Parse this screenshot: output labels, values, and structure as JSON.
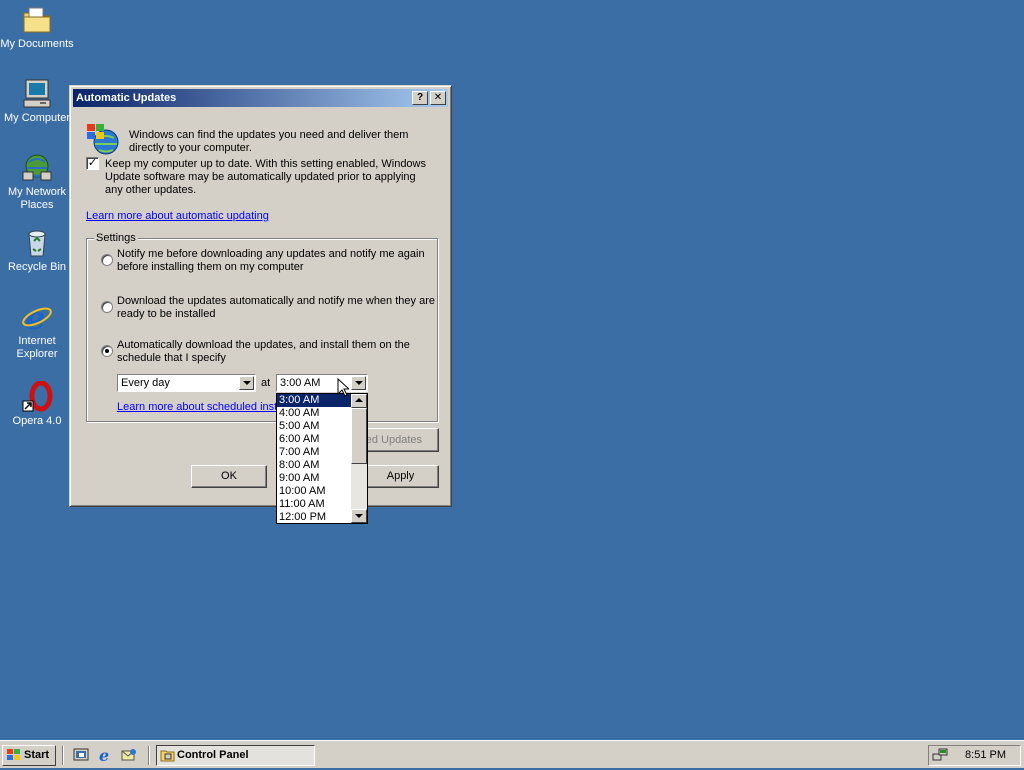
{
  "desktop": {
    "icons": [
      {
        "label": "My Documents",
        "icon": "folder-documents-icon"
      },
      {
        "label": "My Computer",
        "icon": "computer-icon"
      },
      {
        "label": "My Network\nPlaces",
        "icon": "network-places-icon"
      },
      {
        "label": "Recycle Bin",
        "icon": "recycle-bin-icon"
      },
      {
        "label": "Internet\nExplorer",
        "icon": "internet-explorer-icon"
      },
      {
        "label": "Opera 4.0",
        "icon": "opera-icon"
      }
    ]
  },
  "dialog": {
    "title": "Automatic Updates",
    "help_button": "?",
    "close_button": "✕",
    "intro_text": "Windows can find the updates you need and deliver them directly to your computer.",
    "keep_updated_checked": true,
    "keep_updated_text": "Keep my computer up to date. With this setting enabled, Windows Update software may be automatically updated prior to applying any other updates.",
    "learn_more_link": "Learn more about automatic updating",
    "settings_group_label": "Settings",
    "options": [
      {
        "text": "Notify me before downloading any updates and notify me again before installing them on my computer",
        "selected": false
      },
      {
        "text": "Download the updates automatically and notify me when they are ready to be installed",
        "selected": false
      },
      {
        "text": "Automatically download the updates, and install them on the schedule that I specify",
        "selected": true
      }
    ],
    "day_select_value": "Every day",
    "at_label": "at",
    "time_select_value": "3:00 AM",
    "schedule_link_visible": "Learn more about scheduled insta",
    "declined_button_visible": "ed Updates",
    "ok_button": "OK",
    "apply_button": "Apply"
  },
  "time_dropdown": {
    "options": [
      "3:00 AM",
      "4:00 AM",
      "5:00 AM",
      "6:00 AM",
      "7:00 AM",
      "8:00 AM",
      "9:00 AM",
      "10:00 AM",
      "11:00 AM",
      "12:00 PM"
    ],
    "selected_index": 0
  },
  "taskbar": {
    "start_label": "Start",
    "task_button_label": "Control Panel",
    "clock": "8:51 PM"
  },
  "colors": {
    "desktop": "#3a6ea5",
    "titlebar_start": "#0a246a",
    "selection": "#0a246a",
    "link": "#0000ff"
  }
}
